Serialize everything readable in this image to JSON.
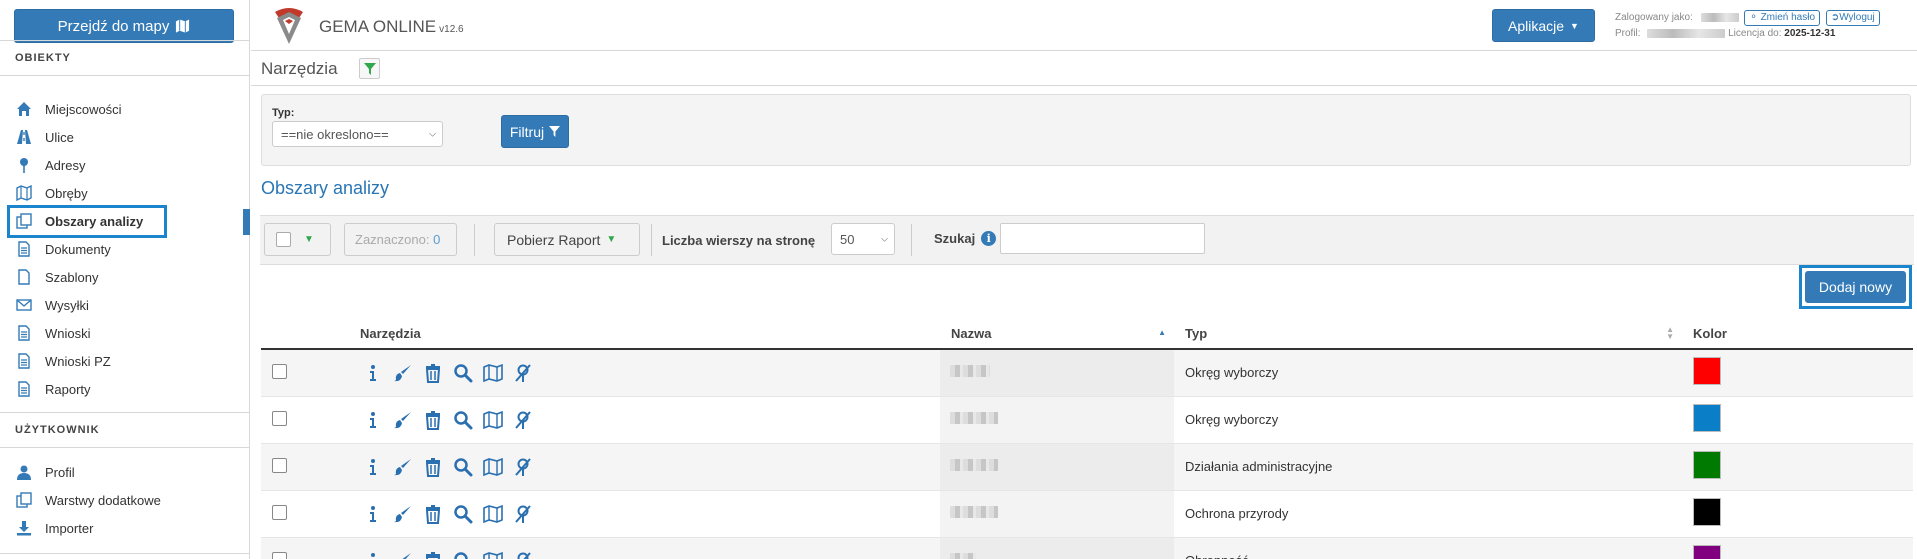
{
  "sidebar": {
    "map_button": "Przejdź do mapy",
    "section1": "OBIEKTY",
    "items1": [
      {
        "label": "Miejscowości",
        "icon": "home-icon"
      },
      {
        "label": "Ulice",
        "icon": "road-icon"
      },
      {
        "label": "Adresy",
        "icon": "map-pin-icon"
      },
      {
        "label": "Obręby",
        "icon": "map-icon"
      },
      {
        "label": "Obszary analizy",
        "icon": "layers-icon"
      },
      {
        "label": "Dokumenty",
        "icon": "document-icon"
      },
      {
        "label": "Szablony",
        "icon": "file-icon"
      },
      {
        "label": "Wysyłki",
        "icon": "envelope-icon"
      },
      {
        "label": "Wnioski",
        "icon": "document-icon"
      },
      {
        "label": "Wnioski PZ",
        "icon": "document-icon"
      },
      {
        "label": "Raporty",
        "icon": "document-icon"
      }
    ],
    "section2": "UŻYTKOWNIK",
    "items2": [
      {
        "label": "Profil",
        "icon": "user-icon"
      },
      {
        "label": "Warstwy dodatkowe",
        "icon": "layers-icon"
      },
      {
        "label": "Importer",
        "icon": "download-icon"
      }
    ]
  },
  "header": {
    "app_name": "GEMA ONLINE",
    "version": "v12.6",
    "apps_button": "Aplikacje",
    "logged_as_label": "Zalogowany jako:",
    "change_password": "Zmień hasło",
    "logout": "Wyloguj",
    "profile_label": "Profil:",
    "license_label": "Licencja do:",
    "license_date": "2025-12-31"
  },
  "page": {
    "title": "Narzędzia",
    "filter": {
      "type_label": "Typ:",
      "type_value": "==nie okreslono==",
      "filter_button": "Filtruj"
    },
    "section_title": "Obszary analizy",
    "toolbar": {
      "selected_label": "Zaznaczono:",
      "selected_count": "0",
      "report_button": "Pobierz Raport",
      "rows_label": "Liczba wierszy na stronę",
      "rows_value": "50",
      "search_label": "Szukaj",
      "add_button": "Dodaj nowy"
    },
    "table": {
      "headers": {
        "tools": "Narzędzia",
        "name": "Nazwa",
        "type": "Typ",
        "color": "Kolor"
      },
      "rows": [
        {
          "type": "Okręg wyborczy",
          "color": "#ff0000"
        },
        {
          "type": "Okręg wyborczy",
          "color": "#0a7fc8"
        },
        {
          "type": "Działania administracyjne",
          "color": "#007a00"
        },
        {
          "type": "Ochrona przyrody",
          "color": "#000000"
        },
        {
          "type": "Obronność",
          "color": "#800080"
        }
      ]
    }
  },
  "colors": {
    "primary": "#337ab7",
    "highlight": "#1a84cc"
  }
}
